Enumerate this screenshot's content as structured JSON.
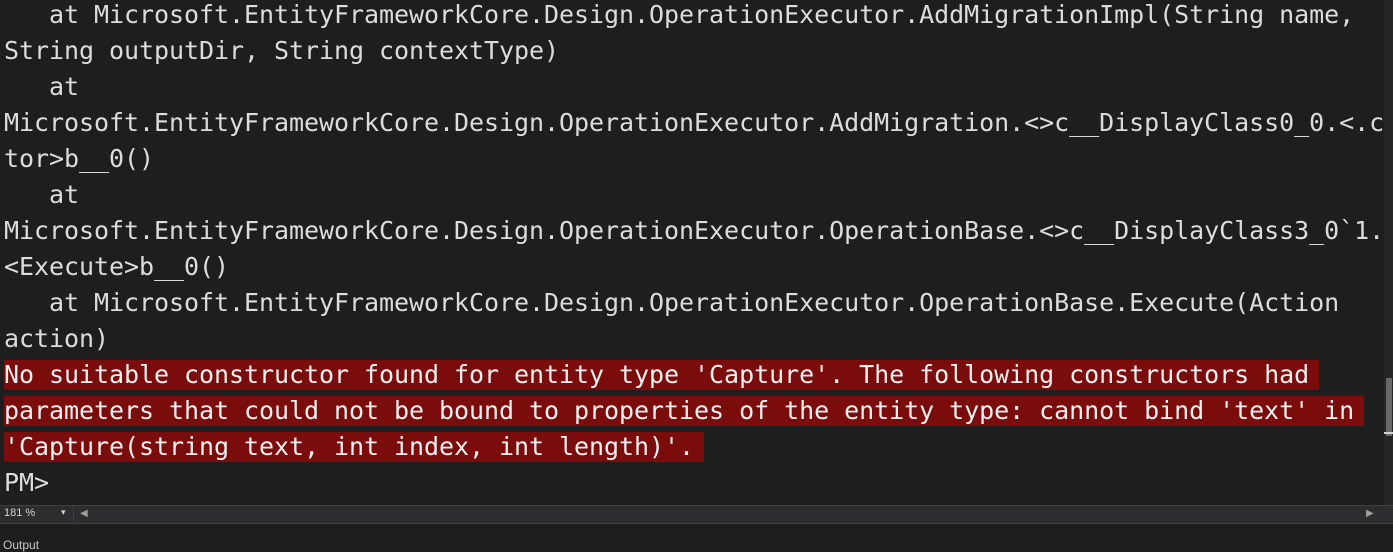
{
  "console": {
    "lines": [
      "   at Microsoft.EntityFrameworkCore.Design.OperationExecutor.AddMigrationImpl(String name,",
      "String outputDir, String contextType)",
      "   at",
      "Microsoft.EntityFrameworkCore.Design.OperationExecutor.AddMigration.<>c__DisplayClass0_0.<.c",
      "tor>b__0()",
      "   at",
      "Microsoft.EntityFrameworkCore.Design.OperationExecutor.OperationBase.<>c__DisplayClass3_0`1.",
      "<Execute>b__0()",
      "   at Microsoft.EntityFrameworkCore.Design.OperationExecutor.OperationBase.Execute(Action",
      "action)"
    ],
    "error_lines": [
      "No suitable constructor found for entity type 'Capture'. The following constructors had",
      "parameters that could not be bound to properties of the entity type: cannot bind 'text' in",
      "'Capture(string text, int index, int length)'."
    ],
    "prompt": "PM>"
  },
  "status_bar": {
    "zoom": "181 %"
  },
  "panel": {
    "tab_label": "Output"
  },
  "colors": {
    "background": "#1e1e1e",
    "text": "#dcdcdc",
    "error_background": "#7a0c0c"
  },
  "icons": {
    "zoom_dropdown": "chevron-down-icon",
    "scroll_left": "arrow-left-icon",
    "scroll_right": "arrow-right-icon"
  }
}
